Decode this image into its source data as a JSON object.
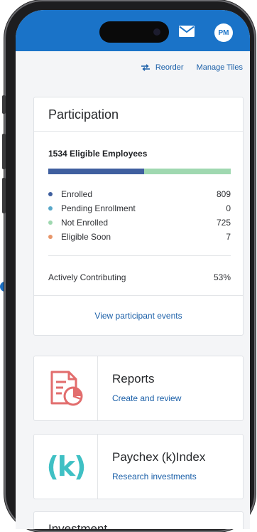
{
  "header": {
    "avatar_initials": "PM",
    "brand_color": "#1a73c8"
  },
  "toolbar": {
    "reorder_label": "Reorder",
    "manage_tiles_label": "Manage Tiles"
  },
  "participation": {
    "title": "Participation",
    "eligible_label": "1534 Eligible Employees",
    "bar_segments": [
      {
        "name": "Enrolled",
        "fraction": 0.527,
        "color": "#3f5f9f"
      },
      {
        "name": "Not Enrolled",
        "fraction": 0.473,
        "color": "#9fd8b0"
      }
    ],
    "legend": [
      {
        "label": "Enrolled",
        "value": "809",
        "color": "#3f5f9f"
      },
      {
        "label": "Pending Enrollment",
        "value": "0",
        "color": "#59a8c9"
      },
      {
        "label": "Not Enrolled",
        "value": "725",
        "color": "#9fd8b0"
      },
      {
        "label": "Eligible Soon",
        "value": "7",
        "color": "#e8966a"
      }
    ],
    "active_label": "Actively Contributing",
    "active_value": "53%",
    "footer_link": "View participant events"
  },
  "tiles": {
    "reports": {
      "title": "Reports",
      "link": "Create and review",
      "icon": "reports-icon"
    },
    "kindex": {
      "title": "Paychex (k)Index",
      "link": "Research investments",
      "icon": "k-index-icon",
      "icon_text": "(k)"
    },
    "investment": {
      "title": "Investment"
    }
  }
}
